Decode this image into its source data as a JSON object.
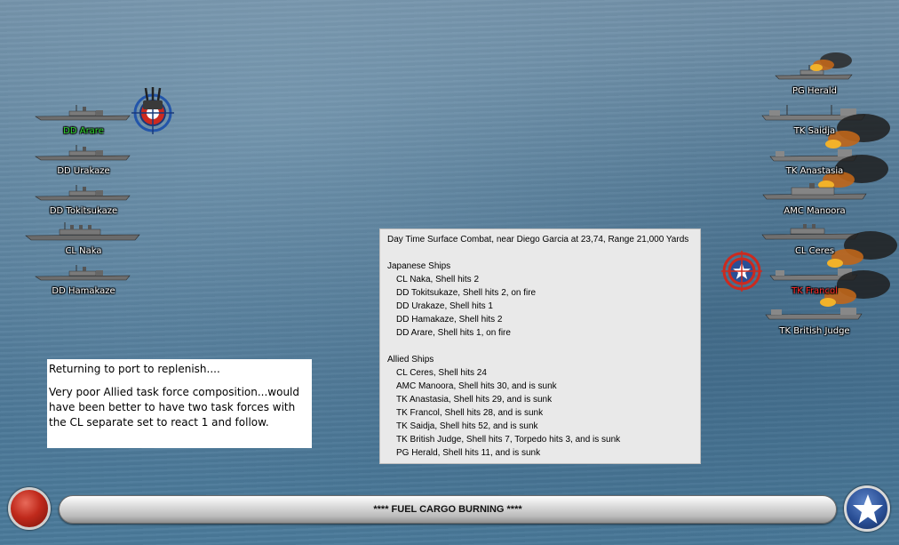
{
  "japanese_ships": [
    {
      "label": "DD Arare",
      "color": "#2fd62f"
    },
    {
      "label": "DD Urakaze",
      "color": "#ffffff"
    },
    {
      "label": "DD Tokitsukaze",
      "color": "#ffffff"
    },
    {
      "label": "CL Naka",
      "color": "#ffffff"
    },
    {
      "label": "DD Hamakaze",
      "color": "#ffffff"
    }
  ],
  "allied_ships": [
    {
      "label": "PG Herald",
      "color": "#ffffff"
    },
    {
      "label": "TK Saidja",
      "color": "#ffffff"
    },
    {
      "label": "TK Anastasia",
      "color": "#ffffff"
    },
    {
      "label": "AMC Manoora",
      "color": "#ffffff"
    },
    {
      "label": "CL Ceres",
      "color": "#ffffff"
    },
    {
      "label": "TK Francol",
      "color": "#ff2a2a"
    },
    {
      "label": "TK British Judge",
      "color": "#ffffff"
    }
  ],
  "combat_log": {
    "header": "Day Time Surface Combat, near Diego Garcia at 23,74, Range 21,000 Yards",
    "japanese_title": "Japanese Ships",
    "japanese_entries": [
      "CL Naka, Shell hits 2",
      "DD Tokitsukaze, Shell hits 2,  on fire",
      "DD Urakaze, Shell hits 1",
      "DD Hamakaze, Shell hits 2",
      "DD Arare, Shell hits 1,  on fire"
    ],
    "allied_title": "Allied Ships",
    "allied_entries": [
      "CL Ceres, Shell hits 24",
      "AMC Manoora, Shell hits 30, and is sunk",
      "TK Anastasia, Shell hits 29, and is sunk",
      "TK Francol, Shell hits 28, and is sunk",
      "TK Saidja, Shell hits 52, and is sunk",
      "TK British Judge, Shell hits 7, Torpedo hits 3, and is sunk",
      "PG Herald, Shell hits 11, and is sunk"
    ]
  },
  "note": {
    "line1": "Returning to port to replenish....",
    "line2": "Very poor Allied task force composition...would have been better to have two task forces with the CL separate set to react 1 and follow."
  },
  "status": {
    "text": "**** FUEL CARGO BURNING ****"
  },
  "icons": {
    "attacker_marker": "naval-gun-target-icon",
    "defender_marker": "allied-target-icon",
    "left_button": "red-button-icon",
    "right_button": "allied-star-icon"
  }
}
